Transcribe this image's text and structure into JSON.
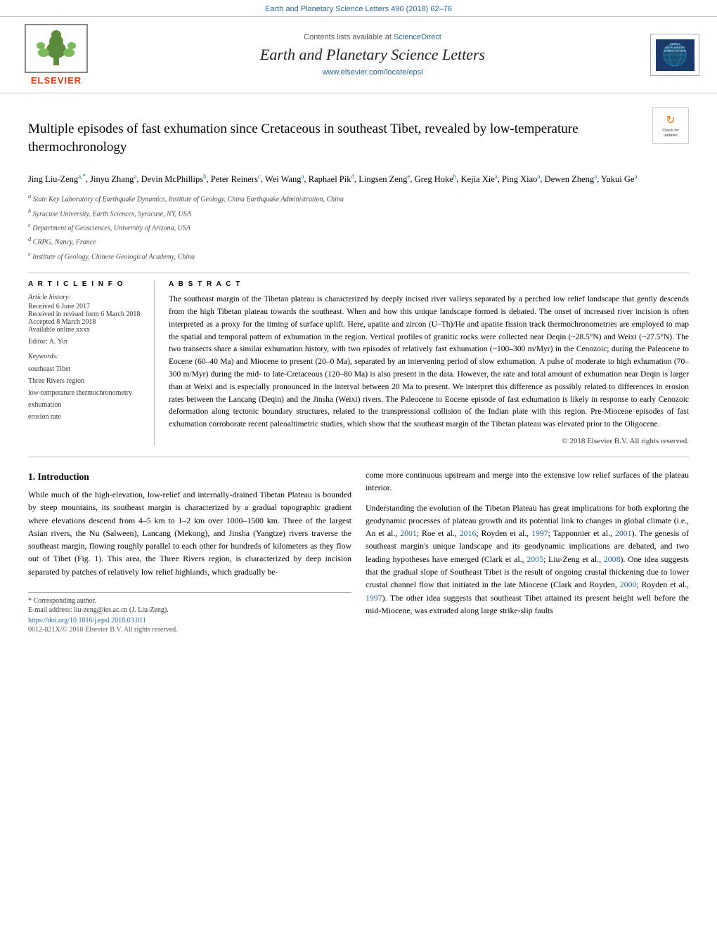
{
  "topBar": {
    "journalRef": "Earth and Planetary Science Letters 490 (2018) 62–76"
  },
  "header": {
    "contentsAvailable": "Contents lists available at",
    "scienceDirect": "ScienceDirect",
    "journalName": "Earth and Planetary Science Letters",
    "journalUrl": "www.elsevier.com/locate/epsl",
    "elsevier": "ELSEVIER",
    "earthLogoTitle": "EARTH AND PLANETARY SCIENCE LETTERS"
  },
  "article": {
    "title": "Multiple episodes of fast exhumation since Cretaceous in southeast Tibet, revealed by low-temperature thermochronology",
    "authors": "Jing Liu-Zeng a,*, Jinyu Zhang a, Devin McPhillips b, Peter Reiners c, Wei Wang a, Raphael Pik d, Lingsen Zeng e, Greg Hoke b, Kejia Xie a, Ping Xiao a, Dewen Zheng a, Yukui Ge a",
    "affiliations": [
      "a State Key Laboratory of Earthquake Dynamics, Institute of Geology, China Earthquake Administration, China",
      "b Syracuse University, Earth Sciences, Syracuse, NY, USA",
      "c Department of Geosciences, University of Arizona, USA",
      "d CRPG, Nancy, France",
      "e Institute of Geology, Chinese Geological Academy, China"
    ]
  },
  "articleInfo": {
    "sectionTitle": "A R T I C L E   I N F O",
    "historyLabel": "Article history:",
    "received": "Received 6 June 2017",
    "receivedRevised": "Received in revised form 6 March 2018",
    "accepted": "Accepted 8 March 2018",
    "available": "Available online xxxx",
    "editor": "Editor: A. Yin",
    "keywordsLabel": "Keywords:",
    "keywords": [
      "southeast Tibet",
      "Three Rivers region",
      "low-temperature thermochronometry",
      "exhumation",
      "erosion rate"
    ]
  },
  "abstract": {
    "sectionTitle": "A B S T R A C T",
    "text": "The southeast margin of the Tibetan plateau is characterized by deeply incised river valleys separated by a perched low relief landscape that gently descends from the high Tibetan plateau towards the southeast. When and how this unique landscape formed is debated. The onset of increased river incision is often interpreted as a proxy for the timing of surface uplift. Here, apatite and zircon (U–Th)/He and apatite fission track thermochronometries are employed to map the spatial and temporal pattern of exhumation in the region. Vertical profiles of granitic rocks were collected near Deqin (~28.5°N) and Weixi (~27.5°N). The two transects share a similar exhumation history, with two episodes of relatively fast exhumation (~100–300 m/Myr) in the Cenozoic; during the Paleocene to Eocene (60–40 Ma) and Miocene to present (20–0 Ma), separated by an intervening period of slow exhumation. A pulse of moderate to high exhumation (70–300 m/Myr) during the mid- to late-Cretaceous (120–80 Ma) is also present in the data. However, the rate and total amount of exhumation near Deqin is larger than at Weixi and is especially pronounced in the interval between 20 Ma to present. We interpret this difference as possibly related to differences in erosion rates between the Lancang (Deqin) and the Jinsha (Weixi) rivers. The Paleocene to Eocene episode of fast exhumation is likely in response to early Cenozoic deformation along tectonic boundary structures, related to the transpressional collision of the Indian plate with this region. Pre-Miocene episodes of fast exhumation corroborate recent paleoaltimetric studies, which show that the southeast margin of the Tibetan plateau was elevated prior to the Oligocene.",
    "copyright": "© 2018 Elsevier B.V. All rights reserved."
  },
  "introduction": {
    "heading": "1. Introduction",
    "paragraph1": "While much of the high-elevation, low-relief and internally-drained Tibetan Plateau is bounded by steep mountains, its southeast margin is characterized by a gradual topographic gradient where elevations descend from 4–5 km to 1–2 km over 1000–1500 km. Three of the largest Asian rivers, the Nu (Salween), Lancang (Mekong), and Jinsha (Yangtze) rivers traverse the southeast margin, flowing roughly parallel to each other for hundreds of kilometers as they flow out of Tibet (Fig. 1). This area, the Three Rivers region, is characterized by deep incision separated by patches of relatively low relief highlands, which gradually be-",
    "paragraph1_right": "come more continuous upstream and merge into the extensive low relief surfaces of the plateau interior.",
    "paragraph2_right": "Understanding the evolution of the Tibetan Plateau has great implications for both exploring the geodynamic processes of plateau growth and its potential link to changes in global climate (i.e., An et al., 2001; Roe et al., 2016; Royden et al., 1997; Tapponnier et al., 2001). The genesis of southeast margin's unique landscape and its geodynamic implications are debated, and two leading hypotheses have emerged (Clark et al., 2005; Liu-Zeng et al., 2008). One idea suggests that the gradual slope of Southeast Tibet is the result of ongoing crustal thickening due to lower crustal channel flow that initiated in the late Miocene (Clark and Royden, 2000; Royden et al., 1997). The other idea suggests that southeast Tibet attained its present height well before the mid-Miocene, was extruded along large strike-slip faults"
  },
  "footnote": {
    "correspondingAuthor": "* Corresponding author.",
    "email": "E-mail address: liu-zeng@ies.ac.cn (J. Liu-Zeng).",
    "doi": "https://doi.org/10.1016/j.epsl.2018.03.011",
    "issn": "0012-821X/© 2018 Elsevier B.V. All rights reserved."
  }
}
